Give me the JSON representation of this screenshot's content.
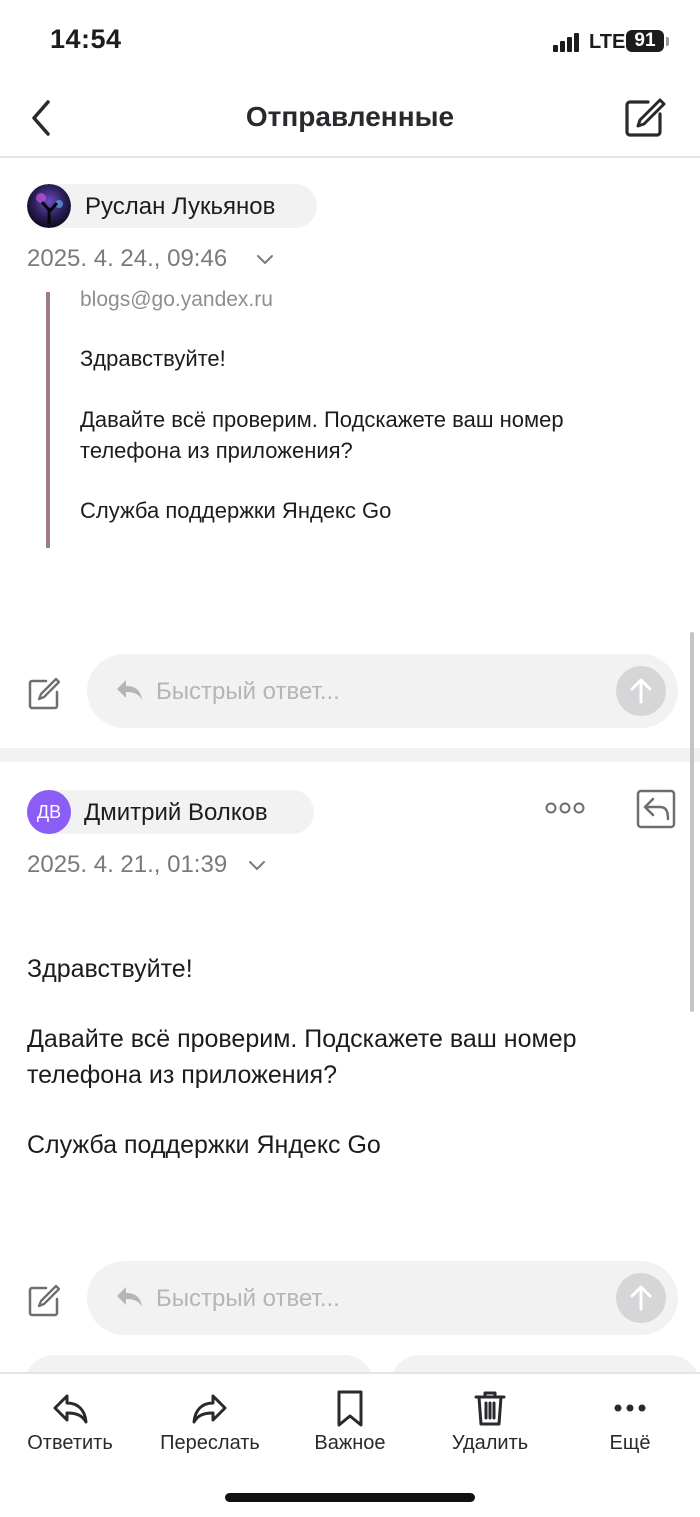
{
  "status": {
    "time": "14:54",
    "network": "LTE",
    "battery": "91"
  },
  "nav": {
    "title": "Отправленные",
    "back_icon": "chevron-left-icon",
    "compose_icon": "compose-icon"
  },
  "messages": [
    {
      "sender": "Руслан Лукьянов",
      "date": "2025. 4. 24., 09:46",
      "quoted": {
        "email": "blogs@go.yandex.ru",
        "greeting": "Здравствуйте!",
        "line1": "Давайте всё проверим. Подскажете ваш номер",
        "line2": "телефона из приложения?",
        "signature": "Служба поддержки Яндекс Go"
      },
      "quick_reply_placeholder": "Быстрый ответ..."
    },
    {
      "sender": "Дмитрий Волков",
      "initials": "ДВ",
      "date": "2025. 4. 21., 01:39",
      "body": {
        "greeting": "Здравствуйте!",
        "line1": "Давайте всё проверим. Подскажете ваш номер",
        "line2": "телефона из приложения?",
        "signature": "Служба поддержки Яндекс Go"
      },
      "quick_reply_placeholder": "Быстрый ответ..."
    }
  ],
  "toolbar": {
    "reply": "Ответить",
    "forward": "Переслать",
    "important": "Важное",
    "delete": "Удалить",
    "more": "Ещё"
  },
  "colors": {
    "avatar_initials_bg": "#8b5cf6",
    "quote_bar": "#a07a88"
  }
}
